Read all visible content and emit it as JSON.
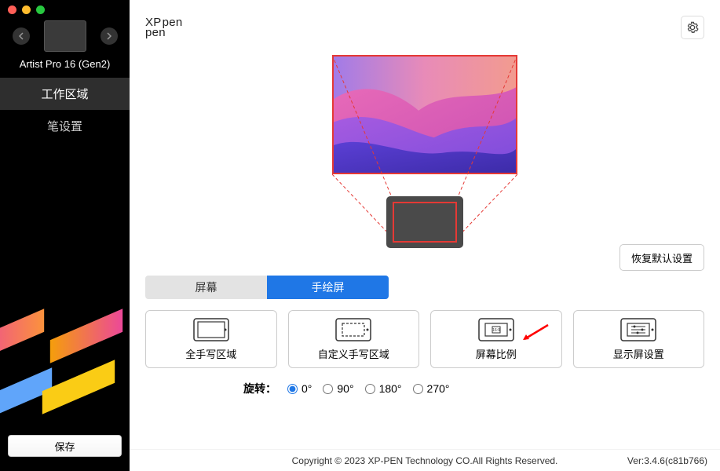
{
  "device": {
    "name": "Artist Pro 16 (Gen2)"
  },
  "menu": {
    "work_area": "工作区域",
    "pen_settings": "笔设置"
  },
  "save_label": "保存",
  "logo": {
    "l1": "XPpen",
    "l2": "pen"
  },
  "restore_label": "恢复默认设置",
  "tabs": {
    "screen": "屏幕",
    "tablet": "手绘屏"
  },
  "options": {
    "full": "全手写区域",
    "custom": "自定义手写区域",
    "ratio": "屏幕比例",
    "display": "显示屏设置"
  },
  "rotation": {
    "label": "旋转：",
    "r0": "0°",
    "r90": "90°",
    "r180": "180°",
    "r270": "270°"
  },
  "footer": {
    "copyright": "Copyright © 2023  XP-PEN Technology CO.All Rights Reserved.",
    "version": "Ver:3.4.6(c81b766)"
  }
}
